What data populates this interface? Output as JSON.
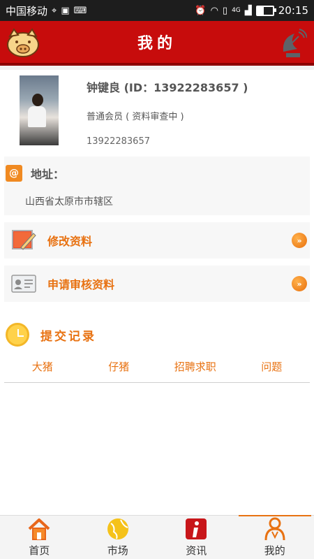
{
  "status_bar": {
    "carrier": "中国移动",
    "network": "4G",
    "time": "20:15"
  },
  "header": {
    "title": "我的"
  },
  "profile": {
    "name": "钟键良 (ID：13922283657 )",
    "level": "普通会员 ( 资料审查中 )",
    "phone": "13922283657"
  },
  "address": {
    "label": "地址：",
    "value": "山西省太原市市辖区"
  },
  "actions": [
    {
      "label": "修改资料",
      "icon": "edit-profile-icon"
    },
    {
      "label": "申请审核资料",
      "icon": "id-card-icon"
    }
  ],
  "records": {
    "title": "提交记录",
    "tabs": [
      "大猪",
      "仔猪",
      "招聘求职",
      "问题"
    ]
  },
  "bottom_nav": [
    {
      "label": "首页",
      "icon": "home-icon",
      "active": false
    },
    {
      "label": "市场",
      "icon": "globe-icon",
      "active": false
    },
    {
      "label": "资讯",
      "icon": "info-icon",
      "active": false
    },
    {
      "label": "我的",
      "icon": "person-icon",
      "active": true
    }
  ],
  "colors": {
    "header_red": "#c70c0c",
    "accent_orange": "#e87212"
  }
}
